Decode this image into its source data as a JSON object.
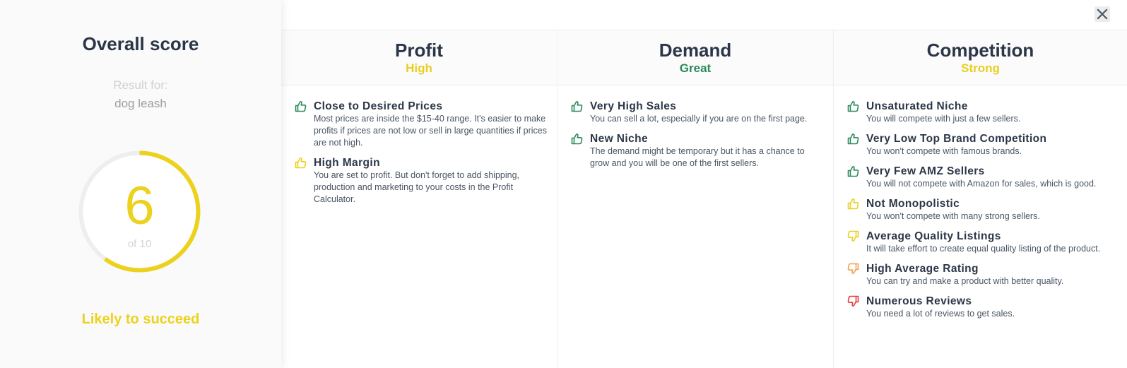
{
  "overall": {
    "title": "Overall score",
    "result_for_label": "Result for:",
    "query": "dog leash",
    "score": "6",
    "score_of": "of 10",
    "score_fraction": 0.6,
    "verdict": "Likely to succeed",
    "accent_color": "#ecd21f",
    "track_color": "#eeeeee"
  },
  "close": {
    "icon": "close-icon"
  },
  "columns": [
    {
      "title": "Profit",
      "level": "High",
      "level_color": "#e8cf1f",
      "items": [
        {
          "icon": "thumbs-up-icon",
          "color": "#2a8a5b",
          "title": "Close to Desired Prices",
          "desc": "Most prices are inside the $15-40 range. It's easier to make profits if prices are not low or sell in large quantities if prices are not high."
        },
        {
          "icon": "thumbs-up-icon",
          "color": "#e8cf1f",
          "title": "High Margin",
          "desc": "You are set to profit. But don't forget to add shipping, production and marketing to your costs in the Profit Calculator."
        }
      ]
    },
    {
      "title": "Demand",
      "level": "Great",
      "level_color": "#2a8a5b",
      "items": [
        {
          "icon": "thumbs-up-icon",
          "color": "#2a8a5b",
          "title": "Very High Sales",
          "desc": "You can sell a lot, especially if you are on the first page."
        },
        {
          "icon": "thumbs-up-icon",
          "color": "#2a8a5b",
          "title": "New Niche",
          "desc": "The demand might be temporary but it has a chance to grow and you will be one of the first sellers."
        }
      ]
    },
    {
      "title": "Competition",
      "level": "Strong",
      "level_color": "#e8cf1f",
      "items": [
        {
          "icon": "thumbs-up-icon",
          "color": "#2a8a5b",
          "title": "Unsaturated Niche",
          "desc": "You will compete with just a few sellers."
        },
        {
          "icon": "thumbs-up-icon",
          "color": "#2a8a5b",
          "title": "Very Low Top Brand Competition",
          "desc": "You won't compete with famous brands."
        },
        {
          "icon": "thumbs-up-icon",
          "color": "#2a8a5b",
          "title": "Very Few AMZ Sellers",
          "desc": "You will not compete with Amazon for sales, which is good."
        },
        {
          "icon": "thumbs-up-icon",
          "color": "#e8cf1f",
          "title": "Not Monopolistic",
          "desc": "You won't compete with many strong sellers."
        },
        {
          "icon": "thumbs-down-icon",
          "color": "#e8cf1f",
          "title": "Average Quality Listings",
          "desc": "It will take effort to create equal quality listing of the product."
        },
        {
          "icon": "thumbs-down-icon",
          "color": "#f0a050",
          "title": "High Average Rating",
          "desc": "You can try and make a product with better quality."
        },
        {
          "icon": "thumbs-down-icon",
          "color": "#e03c3c",
          "title": "Numerous Reviews",
          "desc": "You need a lot of reviews to get sales."
        }
      ]
    }
  ]
}
